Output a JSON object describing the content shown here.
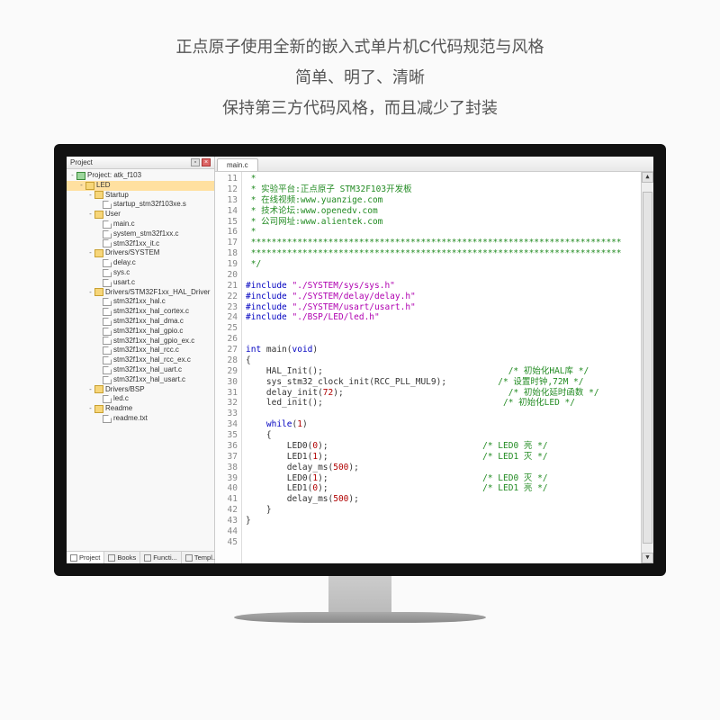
{
  "caption": {
    "l1": "正点原子使用全新的嵌入式单片机C代码规范与风格",
    "l2": "简单、明了、清晰",
    "l3": "保持第三方代码风格，而且减少了封装"
  },
  "panel": {
    "title": "Project",
    "pin": "▫",
    "close": "×"
  },
  "tree": {
    "root": "Project: atk_f103",
    "n0": "LED",
    "startup": "Startup",
    "startup1": "startup_stm32f103xe.s",
    "user": "User",
    "u1": "main.c",
    "u2": "system_stm32f1xx.c",
    "u3": "stm32f1xx_it.c",
    "dsys": "Drivers/SYSTEM",
    "ds1": "delay.c",
    "ds2": "sys.c",
    "ds3": "usart.c",
    "hal": "Drivers/STM32F1xx_HAL_Driver",
    "h1": "stm32f1xx_hal.c",
    "h2": "stm32f1xx_hal_cortex.c",
    "h3": "stm32f1xx_hal_dma.c",
    "h4": "stm32f1xx_hal_gpio.c",
    "h5": "stm32f1xx_hal_gpio_ex.c",
    "h6": "stm32f1xx_hal_rcc.c",
    "h7": "stm32f1xx_hal_rcc_ex.c",
    "h8": "stm32f1xx_hal_uart.c",
    "h9": "stm32f1xx_hal_usart.c",
    "bsp": "Drivers/BSP",
    "b1": "led.c",
    "readme": "Readme",
    "r1": "readme.txt"
  },
  "bottomTabs": {
    "t1": "Project",
    "t2": "Books",
    "t3": "Functi...",
    "t4": "Templ..."
  },
  "editor": {
    "activeTab": "main.c"
  },
  "lines": [
    "11",
    "12",
    "13",
    "14",
    "15",
    "16",
    "17",
    "18",
    "19",
    "20",
    "21",
    "22",
    "23",
    "24",
    "25",
    "26",
    "27",
    "28",
    "29",
    "30",
    "31",
    "32",
    "33",
    "34",
    "35",
    "36",
    "37",
    "38",
    "39",
    "40",
    "41",
    "42",
    "43",
    "44",
    "45"
  ],
  "code": {
    "c11": " *",
    "c12": " * 实验平台:正点原子 STM32F103开发板",
    "c13": " * 在线视频:www.yuanzige.com",
    "c14": " * 技术论坛:www.openedv.com",
    "c15": " * 公司网址:www.alientek.com",
    "c16": " *",
    "c17": " ************************************************************************",
    "c18": " ************************************************************************",
    "c19": " */",
    "inc": "#include",
    "s1": "\"./SYSTEM/sys/sys.h\"",
    "s2": "\"./SYSTEM/delay/delay.h\"",
    "s3": "\"./SYSTEM/usart/usart.h\"",
    "s4": "\"./BSP/LED/led.h\"",
    "kw_int": "int",
    "kw_void": "void",
    "kw_while": "while",
    "main": " main(",
    "mainEnd": ")",
    "brace": "{",
    "braceEnd": "}",
    "l29a": "    HAL_Init();",
    "l29c": "/* 初始化HAL库 */",
    "l30a": "    sys_stm32_clock_init(RCC_PLL_MUL9);",
    "l30c": "/* 设置时钟,72M */",
    "l31a": "    delay_init(",
    "n72": "72",
    "l31b": ");",
    "l31c": "/* 初始化延时函数 */",
    "l32a": "    led_init();",
    "l32c": "/* 初始化LED */",
    "l34a": "    ",
    "l34b": "(",
    "n1": "1",
    "l34c": ")",
    "l36a": "        LED0(",
    "n0": "0",
    "l36b": ");",
    "l36c": "/* LED0 亮 */",
    "l37a": "        LED1(",
    "l37c": "/* LED1 灭 */",
    "l38a": "        delay_ms(",
    "n500": "500",
    "l39c": "/* LED0 灭 */",
    "l40c": "/* LED1 亮 */"
  },
  "pad29": "                                    ",
  "pad30": "          ",
  "pad31": "                                ",
  "pad32": "                                   ",
  "pad36": "                              ",
  "pad38": "",
  "scroll": {
    "up": "▲",
    "down": "▼"
  }
}
